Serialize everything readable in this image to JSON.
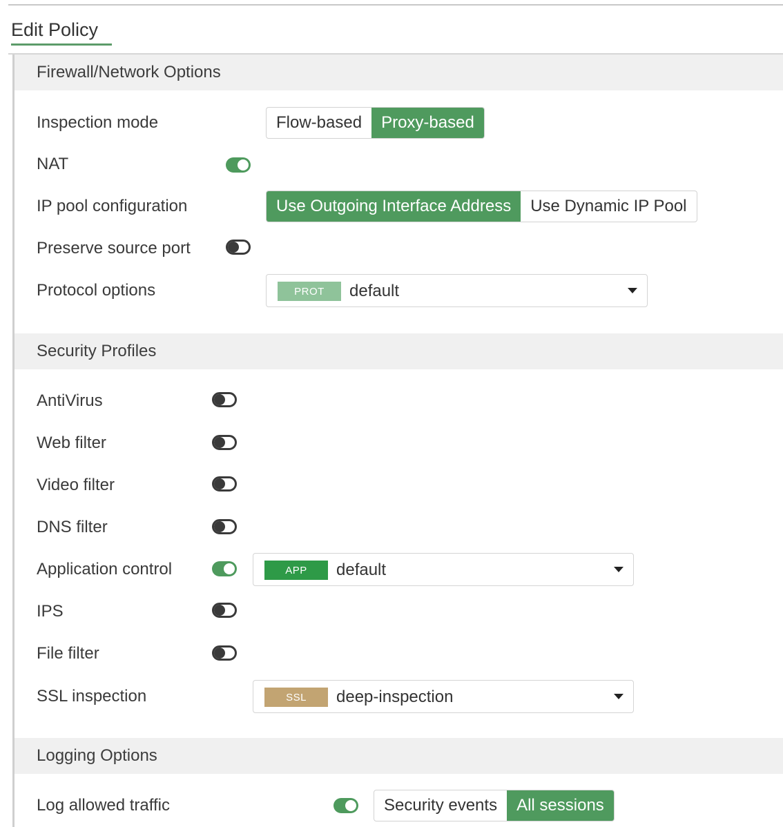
{
  "header": {
    "title": "Edit Policy"
  },
  "firewall": {
    "title": "Firewall/Network Options",
    "inspection_mode": {
      "label": "Inspection mode",
      "options": [
        "Flow-based",
        "Proxy-based"
      ],
      "selected": "Proxy-based"
    },
    "nat": {
      "label": "NAT",
      "enabled": true
    },
    "ip_pool": {
      "label": "IP pool configuration",
      "options": [
        "Use Outgoing Interface Address",
        "Use Dynamic IP Pool"
      ],
      "selected": "Use Outgoing Interface Address"
    },
    "preserve_source_port": {
      "label": "Preserve source port",
      "enabled": false
    },
    "protocol_options": {
      "label": "Protocol options",
      "tag": "PROT",
      "value": "default"
    }
  },
  "security": {
    "title": "Security Profiles",
    "antivirus": {
      "label": "AntiVirus",
      "enabled": false
    },
    "web_filter": {
      "label": "Web filter",
      "enabled": false
    },
    "video_filter": {
      "label": "Video filter",
      "enabled": false
    },
    "dns_filter": {
      "label": "DNS filter",
      "enabled": false
    },
    "application_control": {
      "label": "Application control",
      "enabled": true,
      "tag": "APP",
      "value": "default"
    },
    "ips": {
      "label": "IPS",
      "enabled": false
    },
    "file_filter": {
      "label": "File filter",
      "enabled": false
    },
    "ssl_inspection": {
      "label": "SSL inspection",
      "tag": "SSL",
      "value": "deep-inspection"
    }
  },
  "logging": {
    "title": "Logging Options",
    "log_allowed_traffic": {
      "label": "Log allowed traffic",
      "enabled": true,
      "options": [
        "Security events",
        "All sessions"
      ],
      "selected": "All sessions"
    }
  },
  "colors": {
    "accent": "#4f9a5e",
    "prot_tag": "#8fc39a",
    "app_tag": "#2e9a47",
    "ssl_tag": "#c2a472"
  }
}
